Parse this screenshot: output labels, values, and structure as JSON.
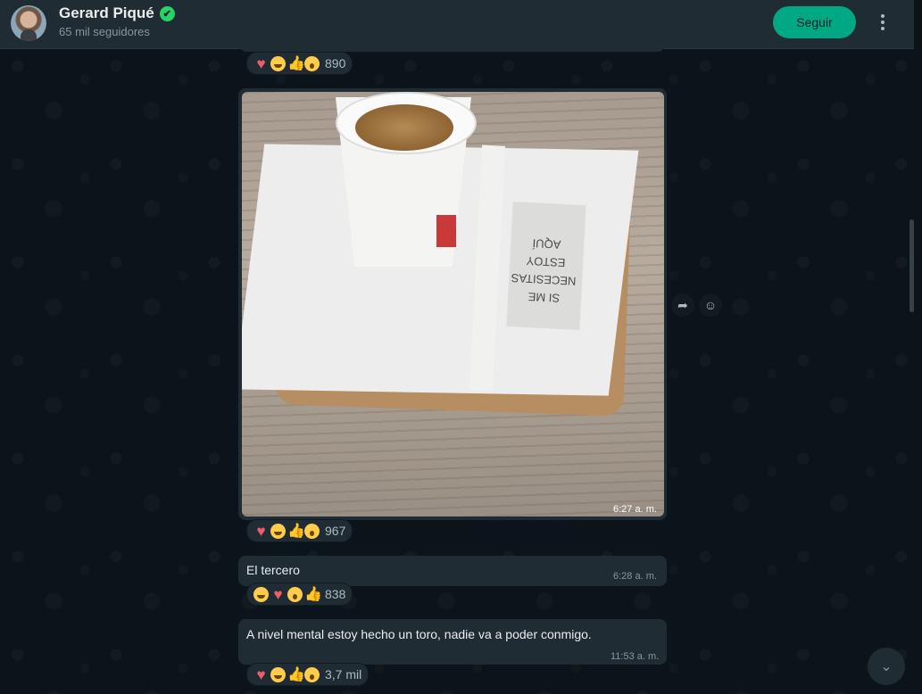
{
  "header": {
    "channel_name": "Gerard Piqué",
    "followers": "65 mil seguidores",
    "follow_label": "Seguir",
    "verified_icon": "verified-check-icon",
    "menu_icon": "more-vertical-icon"
  },
  "messages": [
    {
      "reactions_count": "890"
    },
    {
      "type": "image",
      "image_text": "SI ME NECESITAS ESTOY AQUÍ",
      "time": "6:27 a. m.",
      "reactions_count": "967"
    },
    {
      "type": "text",
      "text": "El tercero",
      "time": "6:28 a. m.",
      "reactions_count": "838"
    },
    {
      "type": "text",
      "text": "A nivel mental estoy hecho un toro, nadie va a poder conmigo.",
      "time": "11:53 a. m.",
      "reactions_count": "3,7 mil"
    }
  ],
  "colors": {
    "accent": "#00a884",
    "bubble": "#202c33",
    "background": "#0b141a"
  }
}
